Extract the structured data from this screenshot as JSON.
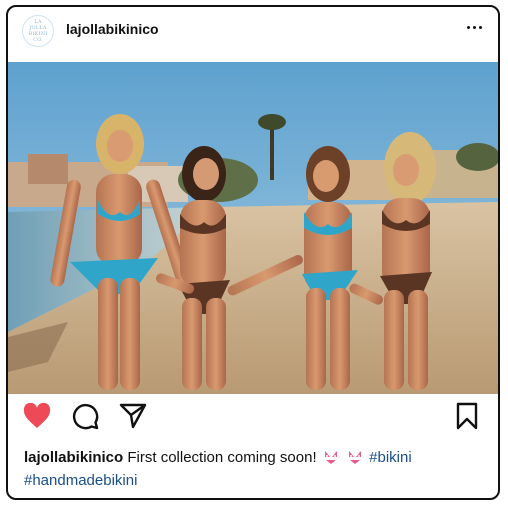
{
  "post": {
    "username": "lajollabikinico",
    "avatar_text_line1": "LA JOLLA",
    "avatar_text_line2": "BIKINI CO.",
    "caption_user": "lajollabikinico",
    "caption_text": "First collection coming soon!",
    "hashtag_1": "#bikini",
    "hashtag_2": "#handmadebikini",
    "photo_alt": "four women holding hands walking on a beach"
  },
  "icons": {
    "like": "heart-icon",
    "comment": "comment-icon",
    "share": "send-icon",
    "save": "bookmark-icon",
    "more": "more-options-icon",
    "emoji": "bikini-emoji-icon"
  },
  "colors": {
    "like_red": "#ed4956",
    "hashtag_blue": "#1a4e8a",
    "text": "#111111",
    "card_border": "#111111"
  }
}
